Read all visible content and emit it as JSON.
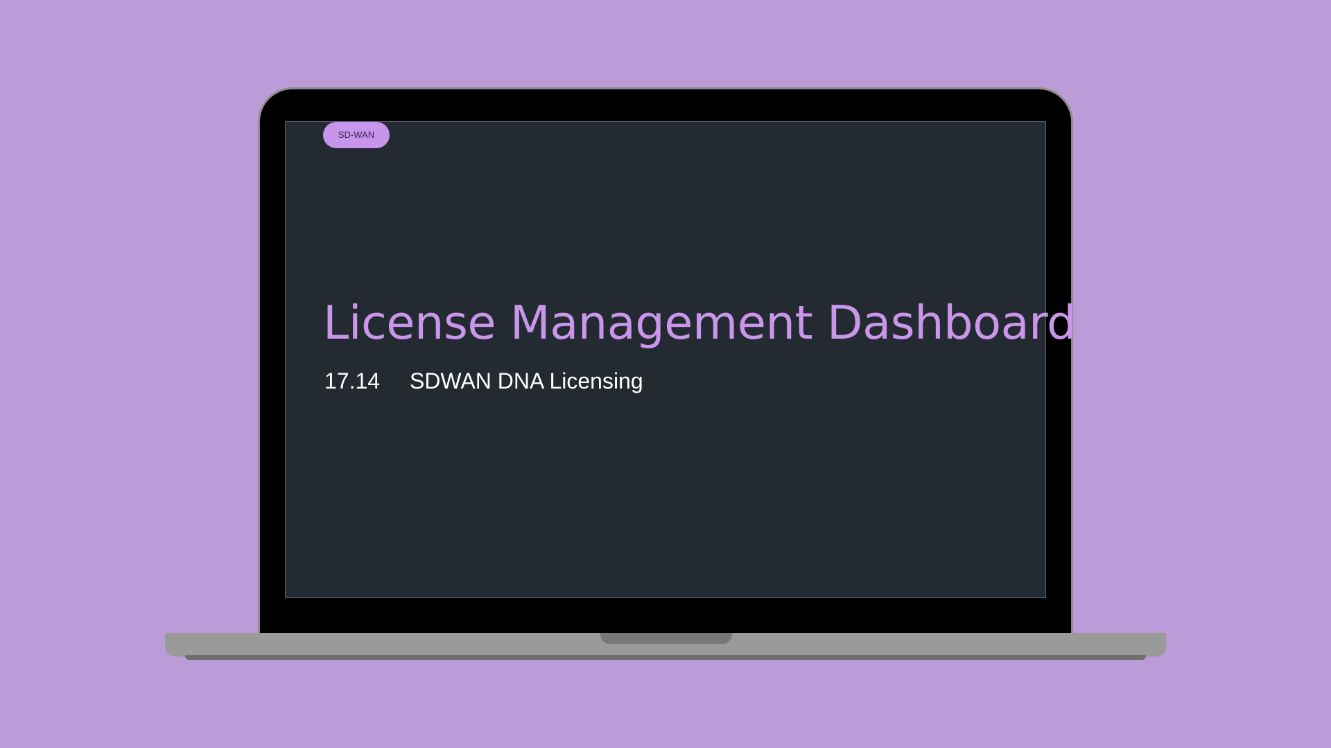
{
  "colors": {
    "background": "#bc9cd8",
    "screen": "#232a32",
    "accent": "#c996ea",
    "tag_bg": "#c895ec",
    "text": "#ffffff"
  },
  "slide": {
    "tag": "SD-WAN",
    "title": "License Management Dashboard",
    "version": "17.14",
    "product": "SDWAN DNA Licensing"
  }
}
